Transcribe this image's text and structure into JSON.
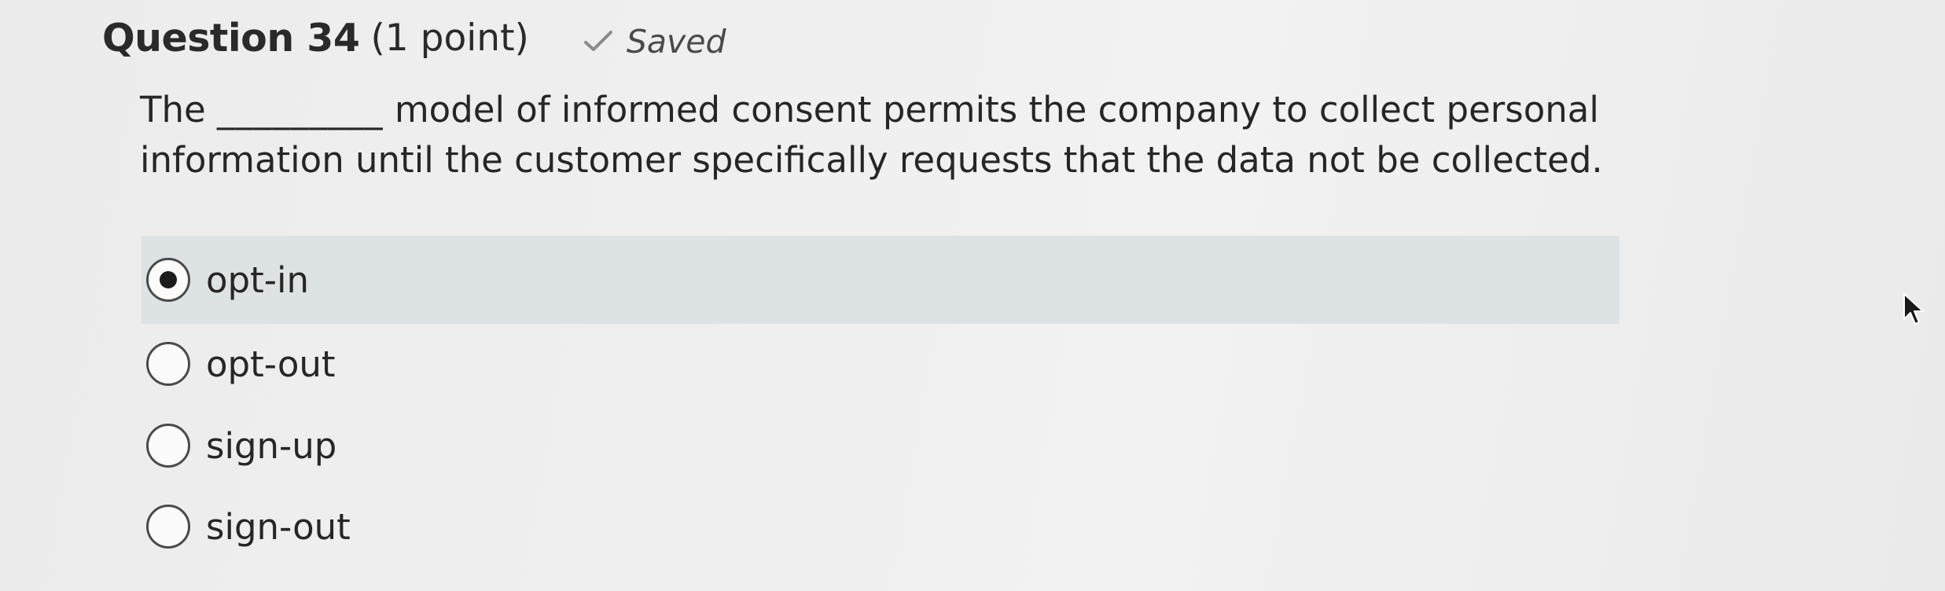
{
  "question": {
    "title": "Question 34",
    "points": "(1 point)",
    "status": "Saved",
    "status_icon": "checkmark-icon",
    "prompt_before": "The",
    "blank": "_________",
    "prompt_after": "model of informed consent permits the company to collect personal information until the customer specifically requests that the data not be collected.",
    "options": [
      {
        "label": "opt-in",
        "selected": true
      },
      {
        "label": "opt-out",
        "selected": false
      },
      {
        "label": "sign-up",
        "selected": false
      },
      {
        "label": "sign-out",
        "selected": false
      }
    ]
  },
  "colors": {
    "selected_row_bg": "#dde2e5",
    "text": "#262626",
    "page_bg": "#efefef"
  }
}
